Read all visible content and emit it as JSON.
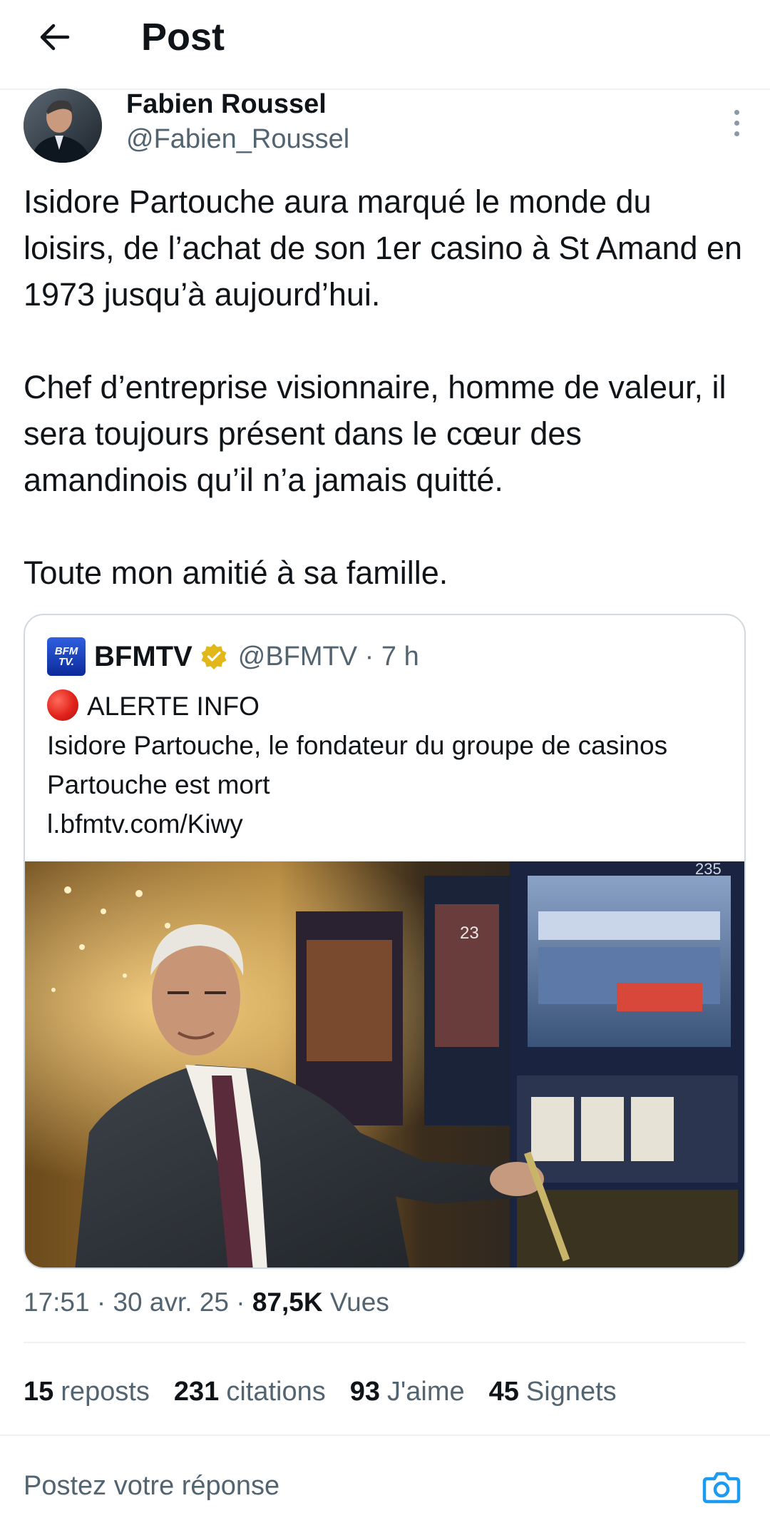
{
  "header": {
    "title": "Post",
    "back_icon": "arrow-left-icon"
  },
  "author": {
    "name": "Fabien Roussel",
    "handle": "@Fabien_Roussel"
  },
  "tweet": {
    "paragraphs": [
      "Isidore Partouche aura marqué le monde du loisirs, de l’achat de son 1er casino à St Amand en 1973 jusqu’à aujourd’hui.",
      "Chef d’entreprise visionnaire, homme de valeur, il sera toujours présent dans le cœur des amandinois qu’il n’a jamais quitté.",
      "Toute mon amitié à sa famille."
    ]
  },
  "quote": {
    "logo_line1": "BFM",
    "logo_line2": "TV.",
    "name": "BFMTV",
    "handle_time": "@BFMTV · 7 h",
    "alert": "ALERTE INFO",
    "text": "Isidore Partouche, le fondateur du groupe de casinos Partouche est mort",
    "link": "l.bfmtv.com/Kiwy",
    "photo_text_machine_number": "23",
    "photo_text_top": "235"
  },
  "meta": {
    "time_date": "17:51 · 30 avr. 25 · ",
    "views_count": "87,5K",
    "views_label": " Vues"
  },
  "stats": [
    {
      "count": "15",
      "label": "reposts"
    },
    {
      "count": "231",
      "label": "citations"
    },
    {
      "count": "93",
      "label": "J'aime"
    },
    {
      "count": "45",
      "label": "Signets"
    }
  ],
  "reply": {
    "placeholder": "Postez votre réponse",
    "camera_icon": "camera-icon"
  },
  "colors": {
    "text": "#0f1419",
    "secondary": "#536471",
    "accent": "#1d9bf0",
    "border": "#cfd9de",
    "verified_gold": "#e2b719"
  }
}
